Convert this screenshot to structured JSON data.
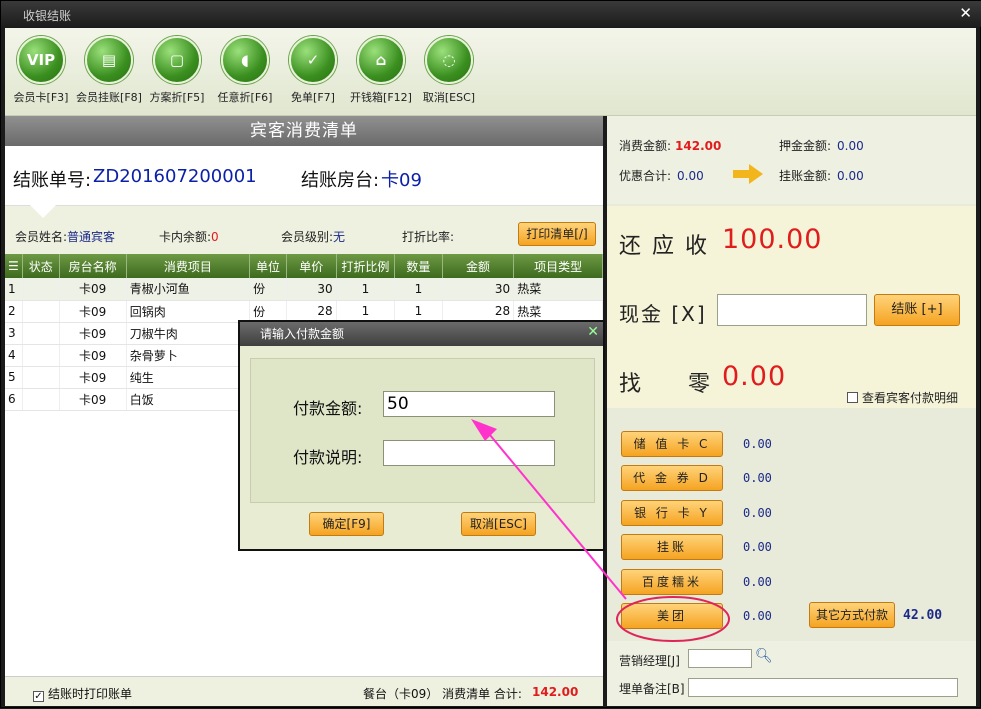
{
  "window": {
    "title": "收银结账"
  },
  "toolbar": {
    "items": [
      {
        "label": "会员卡[F3]",
        "icon": "vip-card-icon",
        "glyph": "VIP"
      },
      {
        "label": "会员挂账[F8]",
        "icon": "member-credit-icon",
        "glyph": "▤"
      },
      {
        "label": "方案折[F5]",
        "icon": "scheme-discount-icon",
        "glyph": "▢"
      },
      {
        "label": "任意折[F6]",
        "icon": "custom-discount-icon",
        "glyph": "◖"
      },
      {
        "label": "免单[F7]",
        "icon": "free-bill-icon",
        "glyph": "✓"
      },
      {
        "label": "开钱箱[F12]",
        "icon": "cash-drawer-icon",
        "glyph": "⌂"
      },
      {
        "label": "取消[ESC]",
        "icon": "cancel-icon",
        "glyph": "◌"
      }
    ]
  },
  "bill": {
    "header": "宾客消费清单",
    "no_label": "结账单号:",
    "no_value": "ZD201607200001",
    "table_label": "结账房台:",
    "table_value": "卡09",
    "member_name_label": "会员姓名:",
    "member_name": "普通宾客",
    "card_balance_label": "卡内余额:",
    "card_balance": "0",
    "member_level_label": "会员级别:",
    "member_level": "无",
    "discount_label": "打折比率:",
    "print_button": "打印清单[/]"
  },
  "grid": {
    "columns": [
      "☰",
      "状态",
      "房台名称",
      "消费项目",
      "单位",
      "单价",
      "打折比例",
      "数量",
      "金额",
      "项目类型"
    ],
    "rows": [
      {
        "n": "1",
        "status": "",
        "table": "卡09",
        "item": "青椒小河鱼",
        "unit": "份",
        "price": "30",
        "disc": "1",
        "qty": "1",
        "amount": "30",
        "type": "热菜"
      },
      {
        "n": "2",
        "status": "",
        "table": "卡09",
        "item": "回锅肉",
        "unit": "份",
        "price": "28",
        "disc": "1",
        "qty": "1",
        "amount": "28",
        "type": "热菜"
      },
      {
        "n": "3",
        "status": "",
        "table": "卡09",
        "item": "刀椒牛肉",
        "unit": "",
        "price": "",
        "disc": "",
        "qty": "",
        "amount": "",
        "type": ""
      },
      {
        "n": "4",
        "status": "",
        "table": "卡09",
        "item": "杂骨萝卜",
        "unit": "",
        "price": "",
        "disc": "",
        "qty": "",
        "amount": "",
        "type": ""
      },
      {
        "n": "5",
        "status": "",
        "table": "卡09",
        "item": "纯生",
        "unit": "",
        "price": "",
        "disc": "",
        "qty": "",
        "amount": "",
        "type": ""
      },
      {
        "n": "6",
        "status": "",
        "table": "卡09",
        "item": "白饭",
        "unit": "",
        "price": "",
        "disc": "",
        "qty": "",
        "amount": "",
        "type": ""
      }
    ]
  },
  "footer": {
    "print_checkbox": "结账时打印账单",
    "summary": "餐台（卡09） 消费清单 合计:",
    "total": "142.00"
  },
  "summary": {
    "consume_label": "消费金额:",
    "consume": "142.00",
    "deposit_label": "押金金额:",
    "deposit": "0.00",
    "discount_label": "优惠合计:",
    "discount": "0.00",
    "credit_label": "挂账金额:",
    "credit": "0.00"
  },
  "due": {
    "label": "还 应 收",
    "value": "100.00"
  },
  "cash": {
    "label": "现金 [X]",
    "value": "",
    "settle_button": "结账 [+]"
  },
  "change": {
    "label": "找     零",
    "value": "0.00",
    "detail_checkbox": "查看宾客付款明细"
  },
  "payments": [
    {
      "label": "储 值 卡 C",
      "value": "0.00"
    },
    {
      "label": "代 金 券 D",
      "value": "0.00"
    },
    {
      "label": "银 行 卡 Y",
      "value": "0.00"
    },
    {
      "label": "挂账",
      "value": "0.00"
    },
    {
      "label": "百度糯米",
      "value": "0.00"
    },
    {
      "label": "美团",
      "value": "0.00"
    }
  ],
  "other_pay": {
    "label": "其它方式付款",
    "value": "42.00"
  },
  "manager": {
    "label": "营销经理[J]",
    "value": ""
  },
  "remark": {
    "label": "埋单备注[B]",
    "value": ""
  },
  "dialog": {
    "title": "请输入付款金额",
    "amount_label": "付款金额:",
    "amount_value": "50",
    "note_label": "付款说明:",
    "note_value": "",
    "ok": "确定[F9]",
    "cancel": "取消[ESC]"
  },
  "colors": {
    "accent_red": "#e01c1c",
    "annotation": "#ff33cc",
    "toolbar_green": "#3a8f1f"
  }
}
